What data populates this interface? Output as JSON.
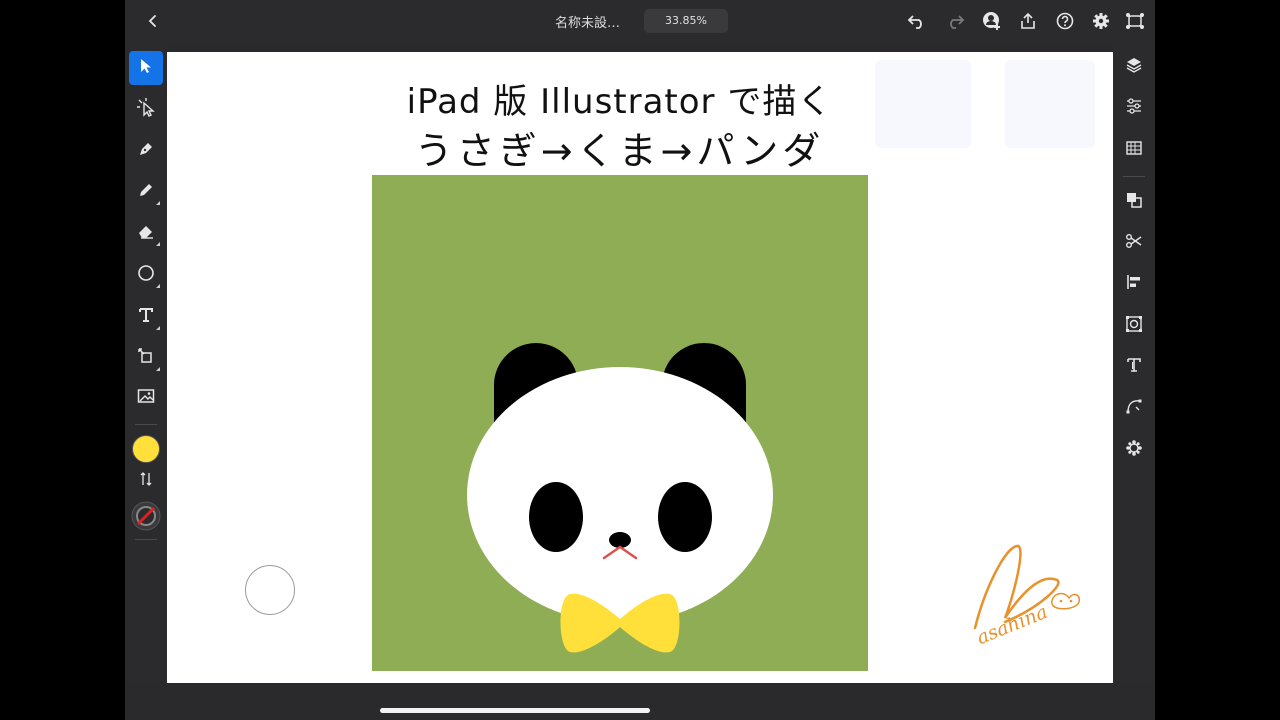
{
  "app": {
    "doc_title": "名称未設…",
    "zoom": "33.85%"
  },
  "toolbar_left": {
    "tools": [
      "selection",
      "direct-selection",
      "pen",
      "pencil",
      "eraser",
      "shape",
      "type",
      "transform",
      "place-image"
    ],
    "fill_color": "#ffe03a",
    "stroke_color": "none"
  },
  "toolbar_right": {
    "tools": [
      "layers",
      "properties",
      "libraries",
      "pathfinder",
      "cut",
      "align",
      "repeat",
      "type-settings",
      "shape-builder",
      "plugins"
    ]
  },
  "artwork": {
    "title_line1": "iPad 版 Illustrator で描く",
    "title_line2": "うさぎ→くま→パンダ",
    "background_color": "#8fad55",
    "face_color": "#ffffff",
    "ears_eyes_color": "#000000",
    "bowtie_color": "#ffe03a",
    "mouth_color": "#d9534f",
    "signature_text": "asahina"
  }
}
